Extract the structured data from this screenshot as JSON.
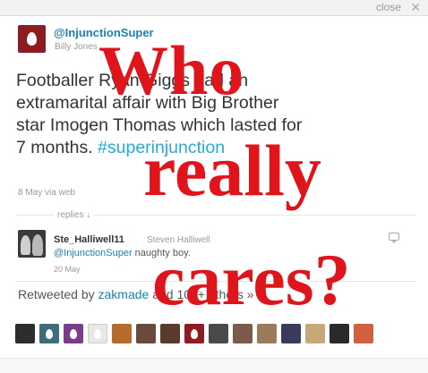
{
  "window": {
    "close_label": "close",
    "close_symbol": "✕"
  },
  "tweet": {
    "avatar_icon": "egg-avatar-icon",
    "handle": "@InjunctionSuper",
    "fullname": "Billy Jones",
    "text": "Footballer Ryan Giggs had an extramarital affair with Big Brother star Imogen Thomas which lasted for 7 months. ",
    "hashtag": "#superinjunction",
    "date": "8 May",
    "via": "via web"
  },
  "replies_label": "replies ↓",
  "reply": {
    "username": "Ste_Halliwell11",
    "fullname": "Steven Halliwell",
    "mention": "@InjunctionSuper",
    "text": " naughty boy.",
    "date": "20 May",
    "icon": "reply-bubble-icon"
  },
  "retweet": {
    "prefix": "Retweeted by ",
    "who": "zakmade",
    "suffix": " and 100+ others »"
  },
  "retweeter_avatars": [
    "#2d2d2d",
    "#3b6e7a",
    "#7a3d8c",
    "#e8e8e8",
    "#b56b2a",
    "#6a4a3a",
    "#5a3a2a",
    "#8c1c22",
    "#4a4a4a",
    "#7a5a4a",
    "#9a7a5a",
    "#3a3a5a",
    "#c8a878",
    "#2a2a2a",
    "#d06040"
  ],
  "overlay": {
    "line1": "Who",
    "line2": "really",
    "line3": "cares?",
    "color": "#e0151b"
  }
}
